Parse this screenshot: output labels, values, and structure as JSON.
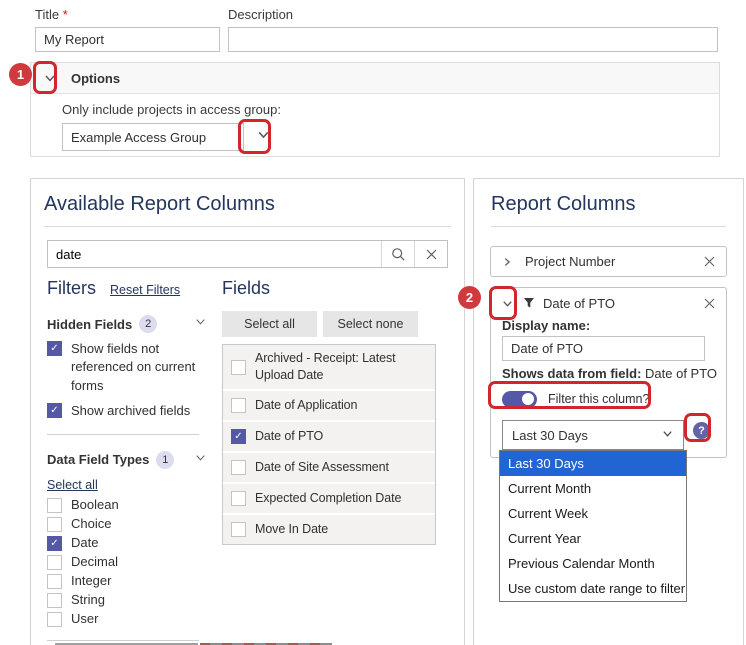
{
  "form": {
    "title_label": "Title",
    "required_mark": "*",
    "title_value": "My Report",
    "description_label": "Description",
    "description_value": ""
  },
  "options": {
    "header": "Options",
    "access_group_label": "Only include projects in access group:",
    "access_group_value": "Example Access Group"
  },
  "annotations": {
    "step1": "1",
    "step2": "2"
  },
  "available_columns": {
    "title": "Available Report Columns",
    "search": {
      "value": "date"
    },
    "filters": {
      "title": "Filters",
      "reset_label": "Reset Filters",
      "hidden_fields": {
        "label": "Hidden Fields",
        "count": "2",
        "options": [
          {
            "label": "Show fields not referenced on current forms",
            "checked": true
          },
          {
            "label": "Show archived fields",
            "checked": true
          }
        ]
      },
      "data_field_types": {
        "label": "Data Field Types",
        "count": "1",
        "select_all_label": "Select all",
        "options": [
          {
            "label": "Boolean",
            "checked": false
          },
          {
            "label": "Choice",
            "checked": false
          },
          {
            "label": "Date",
            "checked": true
          },
          {
            "label": "Decimal",
            "checked": false
          },
          {
            "label": "Integer",
            "checked": false
          },
          {
            "label": "String",
            "checked": false
          },
          {
            "label": "User",
            "checked": false
          }
        ]
      }
    },
    "fields": {
      "title": "Fields",
      "select_all_label": "Select all",
      "select_none_label": "Select none",
      "items": [
        {
          "label": "Archived - Receipt: Latest Upload Date",
          "checked": false
        },
        {
          "label": "Date of Application",
          "checked": false
        },
        {
          "label": "Date of PTO",
          "checked": true
        },
        {
          "label": "Date of Site Assessment",
          "checked": false
        },
        {
          "label": "Expected Completion Date",
          "checked": false
        },
        {
          "label": "Move In Date",
          "checked": false
        }
      ]
    }
  },
  "report_columns": {
    "title": "Report Columns",
    "collapsed_column": {
      "label": "Project Number"
    },
    "expanded_column": {
      "label": "Date of PTO",
      "display_name_label": "Display name:",
      "display_name_value": "Date of PTO",
      "source_label": "Shows data from field:",
      "source_value": "Date of PTO",
      "filter_toggle_label": "Filter this column?",
      "filter_toggle_on": true,
      "range_value": "Last 30 Days",
      "help_icon": "?"
    },
    "range_dropdown": {
      "options": [
        "Last 30 Days",
        "Current Month",
        "Current Week",
        "Current Year",
        "Previous Calendar Month",
        "Use custom date range to filter"
      ],
      "selected": "Last 30 Days"
    }
  },
  "colors": {
    "accent_purple": "#5558a6",
    "annotation_red": "#d0262c",
    "selection_blue": "#2065d1",
    "help_purple": "#6264a7",
    "heading_navy": "#24365c"
  }
}
